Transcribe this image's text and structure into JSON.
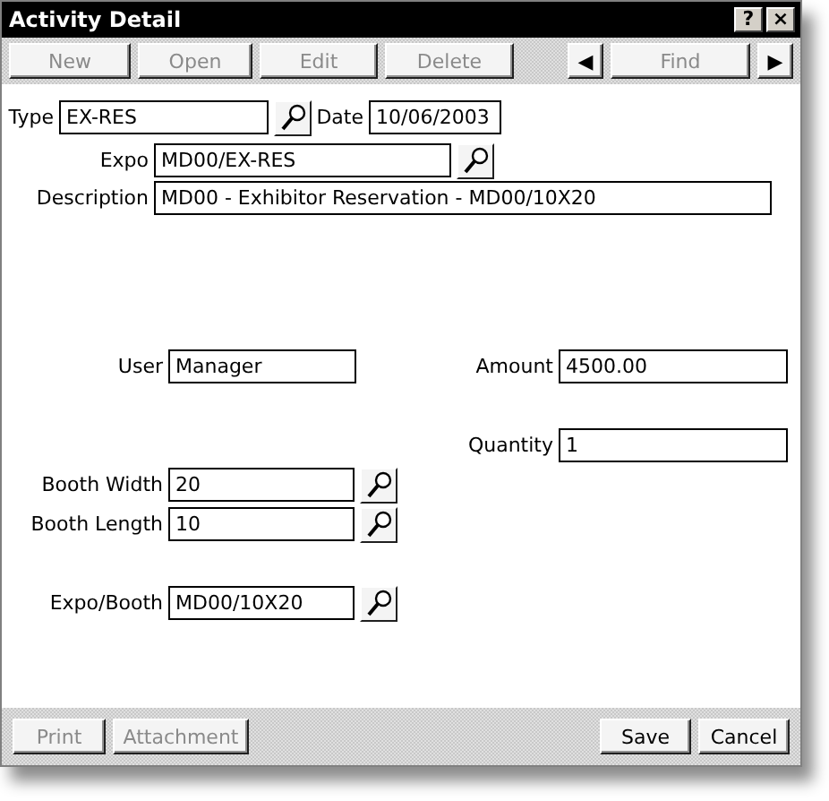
{
  "window": {
    "title": "Activity Detail",
    "title_buttons": [
      "?",
      "×"
    ]
  },
  "toolbar": {
    "left": [
      {
        "label": "New",
        "disabled": true
      },
      {
        "label": "Open",
        "disabled": true
      },
      {
        "label": "Edit",
        "disabled": true
      },
      {
        "label": "Delete",
        "disabled": true
      }
    ],
    "prev": "◀",
    "find": {
      "label": "Find",
      "disabled": true
    },
    "next": "▶"
  },
  "form": {
    "type": {
      "label": "Type",
      "value": "EX-RES"
    },
    "date": {
      "label": "Date",
      "value": "10/06/2003"
    },
    "expo": {
      "label": "Expo",
      "value": "MD00/EX-RES"
    },
    "description": {
      "label": "Description",
      "value": "MD00 - Exhibitor Reservation - MD00/10X20"
    },
    "user": {
      "label": "User",
      "value": "Manager"
    },
    "amount": {
      "label": "Amount",
      "value": "4500.00"
    },
    "quantity": {
      "label": "Quantity",
      "value": "1"
    },
    "booth_width": {
      "label": "Booth Width",
      "value": "20"
    },
    "booth_length": {
      "label": "Booth Length",
      "value": "10"
    },
    "expo_booth": {
      "label": "Expo/Booth",
      "value": "MD00/10X20"
    }
  },
  "footer": {
    "left": [
      {
        "label": "Print",
        "disabled": true
      },
      {
        "label": "Attachment",
        "disabled": true
      }
    ],
    "right": [
      {
        "label": "Save",
        "disabled": false
      },
      {
        "label": "Cancel",
        "disabled": false
      }
    ]
  }
}
